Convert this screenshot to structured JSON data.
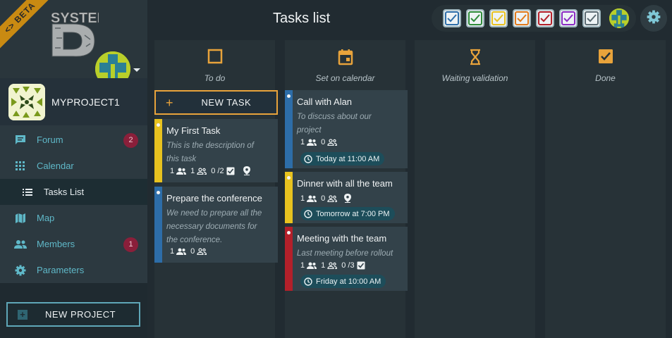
{
  "app": {
    "beta_label": "<> BETA",
    "logo_text": "SYSTEM D"
  },
  "sidebar": {
    "project_name": "MYPROJECT1",
    "items": [
      {
        "label": "Forum",
        "icon": "forum-icon",
        "badge": "2"
      },
      {
        "label": "Calendar",
        "icon": "calendar-grid-icon",
        "badge": ""
      },
      {
        "label": "Tasks List",
        "icon": "list-icon",
        "badge": "",
        "active": true
      },
      {
        "label": "Map",
        "icon": "map-icon",
        "badge": ""
      },
      {
        "label": "Members",
        "icon": "members-icon",
        "badge": "1"
      },
      {
        "label": "Parameters",
        "icon": "gear-icon",
        "badge": ""
      }
    ],
    "new_project_label": "NEW PROJECT"
  },
  "header": {
    "title": "Tasks list",
    "filters": [
      {
        "color": "#2d6da8",
        "checked": true
      },
      {
        "color": "#2e8b3a",
        "checked": true
      },
      {
        "color": "#e8c21f",
        "checked": true
      },
      {
        "color": "#e07a1c",
        "checked": true
      },
      {
        "color": "#b3202a",
        "checked": true
      },
      {
        "color": "#8a2bc2",
        "checked": true
      },
      {
        "color": "#5c6c74",
        "checked": true
      }
    ]
  },
  "columns": [
    {
      "title": "To do",
      "icon": "square-outline-icon"
    },
    {
      "title": "Set on calendar",
      "icon": "calendar-icon"
    },
    {
      "title": "Waiting validation",
      "icon": "hourglass-icon"
    },
    {
      "title": "Done",
      "icon": "checked-box-icon"
    }
  ],
  "new_task_label": "NEW TASK",
  "cards": {
    "todo": [
      {
        "title": "My First Task",
        "desc1": "This is the description of",
        "desc2": "this task",
        "desc3": "",
        "members": "1",
        "groups": "1",
        "checklist": "0 /2",
        "color": "#e8c21f"
      },
      {
        "title": "Prepare the conference",
        "desc1": "We need to prepare all the",
        "desc2": "necessary documents for",
        "desc3": "the conference.",
        "members": "1",
        "groups": "0",
        "color": "#2d6da8"
      }
    ],
    "calendar": [
      {
        "title": "Call with Alan",
        "desc1": "To discuss about our",
        "desc2": "project",
        "members": "1",
        "groups": "0",
        "date": "Today at 11:00 AM",
        "color": "#2d6da8"
      },
      {
        "title": "Dinner with all the team",
        "members": "1",
        "groups": "0",
        "date": "Tomorrow at 7:00 PM",
        "color": "#e8c21f"
      },
      {
        "title": "Meeting with the team",
        "desc1": "Last meeting before rollout",
        "members": "1",
        "groups": "1",
        "checklist": "0 /3",
        "date": "Friday at 10:00 AM",
        "color": "#b3202a"
      }
    ]
  }
}
